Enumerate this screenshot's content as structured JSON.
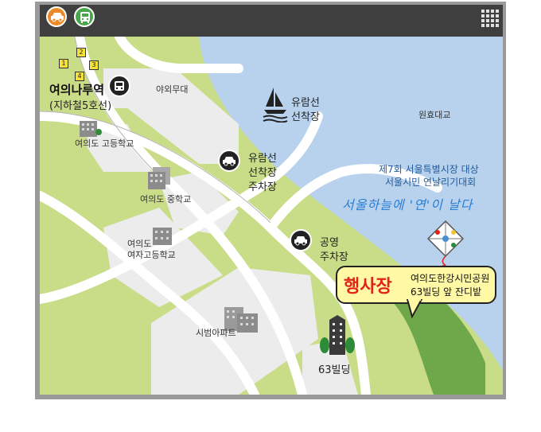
{
  "toolbar": {
    "car_icon": "car-icon",
    "bus_icon": "bus-icon",
    "menu_icon": "grid-menu-icon"
  },
  "colors": {
    "river": "#b8d2ee",
    "land": "#c9dc88",
    "road": "#ffffff",
    "block": "#ececec",
    "park": "#6fa84a",
    "accent_red": "#e2231a",
    "callout_bg": "#fff9a6"
  },
  "station": {
    "name": "여의나루역",
    "line": "(지하철5호선)",
    "exits": [
      "1",
      "2",
      "3",
      "4"
    ]
  },
  "places": {
    "outdoor_stage": "야외무대",
    "cruise_dock": [
      "유람선",
      "선착장"
    ],
    "cruise_parking": [
      "유람선",
      "선착장",
      "주차장"
    ],
    "public_parking": [
      "공영",
      "주차장"
    ],
    "bridge": "원효대교",
    "high_school": "여의도 고등학교",
    "middle_school": "여의도 중학교",
    "girls_high_school": [
      "여의도",
      "여자고등학교"
    ],
    "apartment": "시범아파트",
    "building_63": "63빌딩"
  },
  "event": {
    "line1": "제7회 서울특별시장 대상",
    "line2": "서울시민 연날리기대회",
    "slogan": "서울하늘에 '연'이 날다"
  },
  "callout": {
    "title": "행사장",
    "line1": "여의도한강시민공원",
    "line2": "63빌딩 앞 잔디밭"
  }
}
